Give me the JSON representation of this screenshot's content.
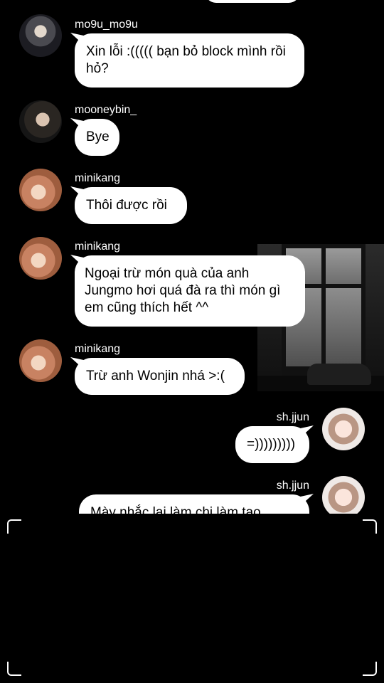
{
  "messages": [
    {
      "user": "mo9u_mo9u",
      "text": "Xin lỗi :((((( bạn bỏ block mình rồi hỏ?",
      "side": "left",
      "avatar": "avatar-mo9u"
    },
    {
      "user": "mooneybin_",
      "text": "Bye",
      "side": "left",
      "avatar": "avatar-mooneybin"
    },
    {
      "user": "minikang",
      "text": "Thôi được rồi",
      "side": "left",
      "avatar": "avatar-minikang"
    },
    {
      "user": "minikang",
      "text": "Ngoại trừ món quà của anh Jungmo hơi quá đà ra thì món gì em cũng thích hết ^^",
      "side": "left",
      "avatar": "avatar-minikang"
    },
    {
      "user": "minikang",
      "text": "Trừ anh Wonjin nhá >:(",
      "side": "left",
      "avatar": "avatar-minikang"
    },
    {
      "user": "sh.jjun",
      "text": "=)))))))))",
      "side": "right",
      "avatar": "avatar-shjjun"
    },
    {
      "user": "sh.jjun",
      "text": "Mày nhắc lại làm chi làm tao",
      "side": "right",
      "avatar": "avatar-shjjun"
    }
  ],
  "colors": {
    "background": "#000000",
    "bubble": "#ffffff",
    "bubble_text": "#000000",
    "username": "#ffffff"
  }
}
